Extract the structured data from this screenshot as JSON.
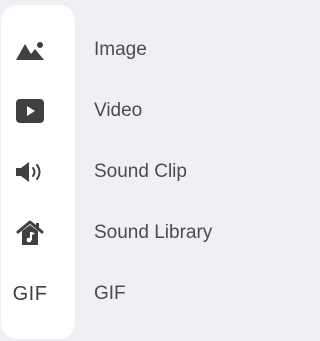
{
  "colors": {
    "background": "#f0f0f4",
    "panel": "#ffffff",
    "icon": "#404040",
    "label": "#4c4c4c"
  },
  "media_menu": {
    "items": [
      {
        "label": "Image",
        "icon": "image-icon"
      },
      {
        "label": "Video",
        "icon": "video-play-icon"
      },
      {
        "label": "Sound Clip",
        "icon": "speaker-icon"
      },
      {
        "label": "Sound Library",
        "icon": "home-music-icon"
      },
      {
        "label": "GIF",
        "icon": "gif-icon",
        "icon_text": "GIF"
      }
    ]
  }
}
